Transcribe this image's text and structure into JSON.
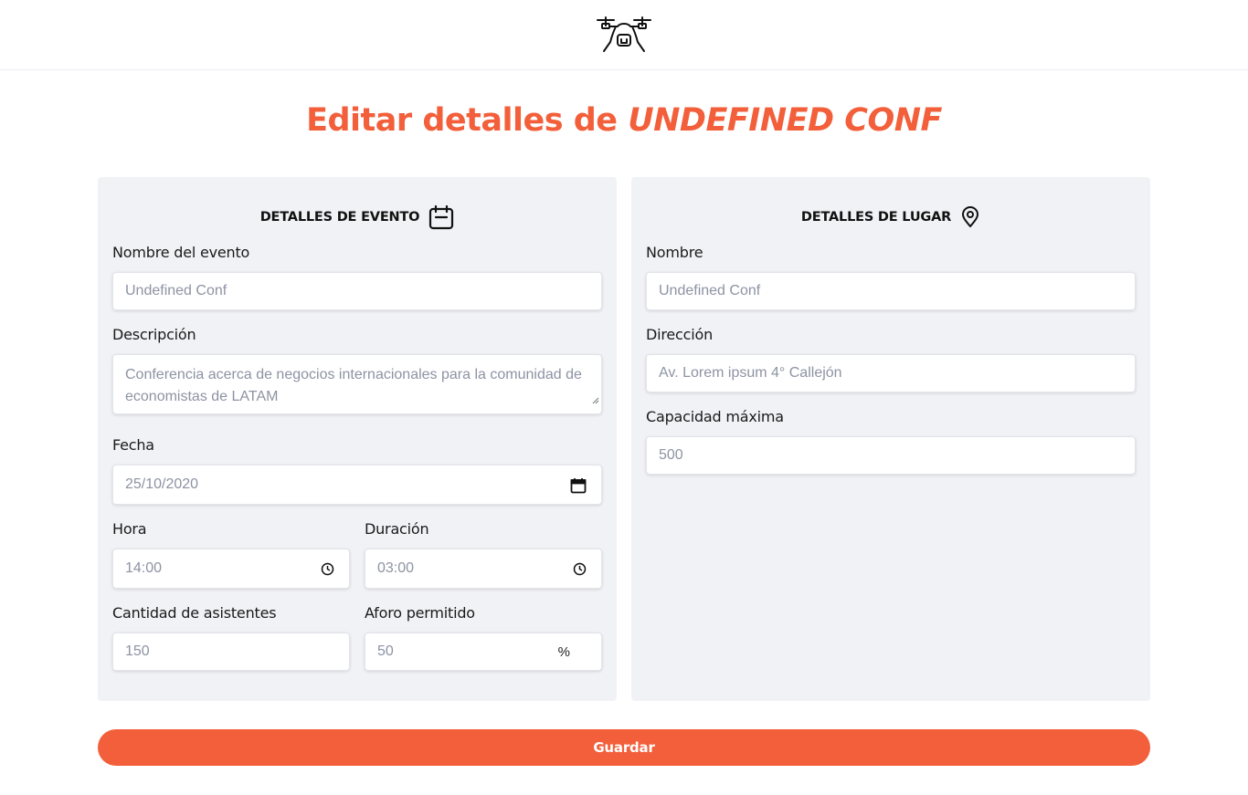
{
  "header": {
    "logo_icon": "drone-icon"
  },
  "title": {
    "prefix": "Editar detalles de ",
    "event_name": "UNDEFINED CONF"
  },
  "colors": {
    "accent": "#f25f3a",
    "card_bg": "#f1f2f6",
    "placeholder": "#8d93a3"
  },
  "event": {
    "heading": "DETALLES DE EVENTO",
    "heading_icon": "calendar-icon",
    "name_label": "Nombre del evento",
    "name_value": "Undefined Conf",
    "description_label": "Descripción",
    "description_value": "Conferencia acerca de negocios internacionales para la comunidad de economistas de LATAM",
    "date_label": "Fecha",
    "date_value": "25/10/2020",
    "time_label": "Hora",
    "time_value": "14:00",
    "duration_label": "Duración",
    "duration_value": "03:00",
    "attendees_label": "Cantidad de asistentes",
    "attendees_value": "150",
    "capacity_pct_label": "Aforo permitido",
    "capacity_pct_value": "50",
    "capacity_pct_suffix": "%"
  },
  "venue": {
    "heading": "DETALLES DE LUGAR",
    "heading_icon": "location-pin-icon",
    "name_label": "Nombre",
    "name_value": "Undefined Conf",
    "address_label": "Dirección",
    "address_value": "Av. Lorem ipsum 4° Callejón",
    "max_capacity_label": "Capacidad máxima",
    "max_capacity_value": "500"
  },
  "actions": {
    "save_label": "Guardar"
  }
}
